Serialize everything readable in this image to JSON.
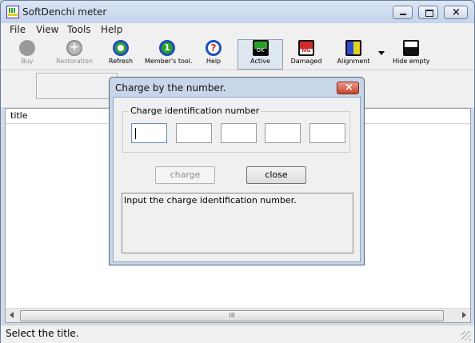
{
  "window": {
    "title": "SoftDenchi meter"
  },
  "menu": [
    "File",
    "View",
    "Tools",
    "Help"
  ],
  "toolbar": {
    "buy": "Buy",
    "restoration": "Restoration",
    "refresh": "Refresh",
    "members_tool": "Member's tool.",
    "help": "Help",
    "active": "Active",
    "damaged": "Damaged",
    "alignment": "Alignment",
    "hide_empty": "Hide empty"
  },
  "icons": {
    "active_badge": "OK",
    "damaged_badge": "NG"
  },
  "list": {
    "column_title": "title",
    "scroll_grip": "III"
  },
  "status": {
    "text": "Select the title."
  },
  "dialog": {
    "title": "Charge by the number.",
    "group_label": "Charge identification number",
    "fields": [
      "",
      "",
      "",
      "",
      ""
    ],
    "charge_button": "charge",
    "close_button": "close",
    "message": "Input the charge identification number."
  },
  "colors": {
    "accent_green": "#2aa02a",
    "accent_red": "#d02a2a",
    "accent_blue": "#2a4ad0",
    "dialog_close": "#c8442c"
  }
}
